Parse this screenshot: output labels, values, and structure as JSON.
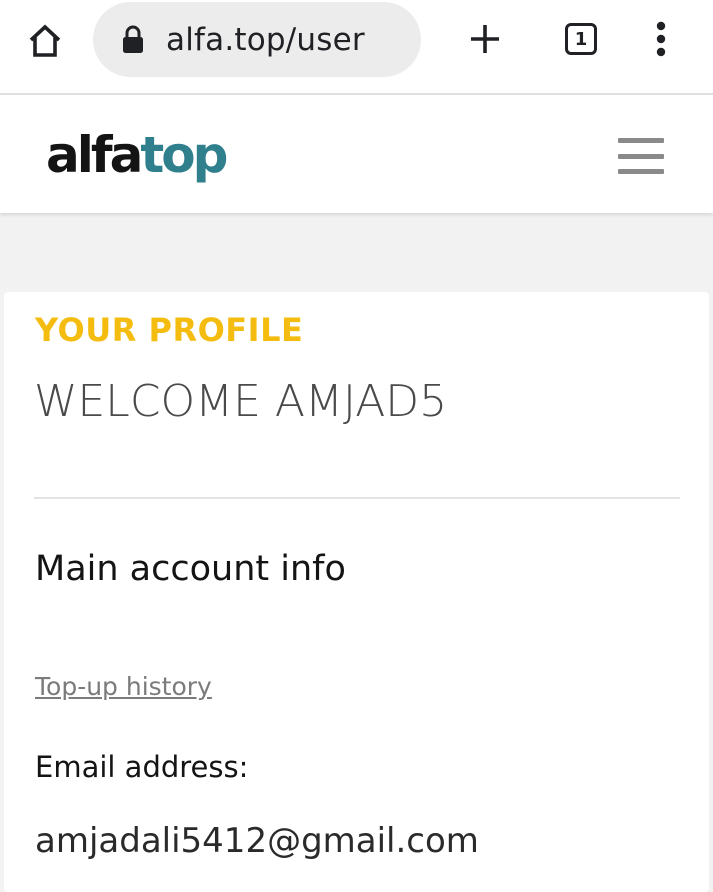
{
  "browser": {
    "url": "alfa.top/user",
    "tab_count": "1",
    "icons": {
      "home": "home-icon",
      "lock": "lock-icon",
      "new_tab": "plus-icon",
      "tabs": "tab-switcher-icon",
      "menu": "more-vert-icon"
    }
  },
  "site": {
    "logo_part1": "alfa",
    "logo_part2": "top",
    "menu_icon": "hamburger-menu-icon",
    "colors": {
      "logo_dark": "#141414",
      "logo_accent": "#2f7f8d",
      "heading_accent": "#f5bc10"
    }
  },
  "profile": {
    "heading": "YOUR PROFILE",
    "welcome": "WELCOME AMJAD5",
    "section_title": "Main account info",
    "topup_link": "Top-up history",
    "email_label": "Email address:",
    "email_value": "amjadali5412@gmail.com"
  }
}
